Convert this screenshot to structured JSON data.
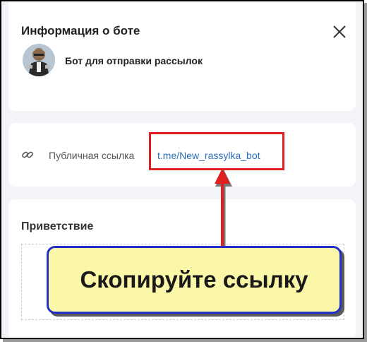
{
  "dialog": {
    "title": "Информация о боте",
    "bot_name": "Бот для отправки рассылок"
  },
  "public_link": {
    "label": "Публичная ссылка",
    "value": "t.me/New_rassylka_bot"
  },
  "greeting": {
    "title": "Приветствие",
    "text": ""
  },
  "annotation": {
    "callout_text": "Скопируйте ссылку",
    "highlight_color": "#e0201f",
    "callout_bg": "#fbf7a8",
    "callout_border": "#2230c8"
  },
  "colors": {
    "link": "#2a6ebb",
    "page_bg": "#f2f4f7"
  }
}
